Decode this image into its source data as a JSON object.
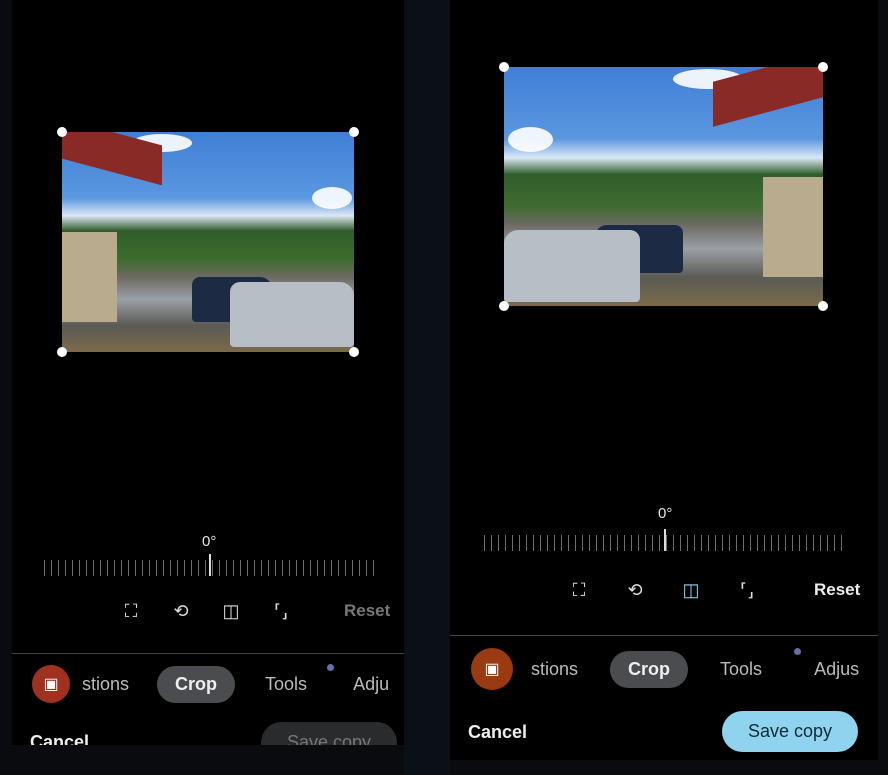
{
  "panels": [
    {
      "state": "original",
      "rotation": "0°",
      "reset_label": "Reset",
      "tabs": {
        "suggestions": "stions",
        "crop": "Crop",
        "tools": "Tools",
        "adjust": "Adju"
      },
      "cancel_label": "Cancel",
      "save_label": "Save copy",
      "save_enabled": false,
      "flip_active": false
    },
    {
      "state": "flipped",
      "rotation": "0°",
      "reset_label": "Reset",
      "tabs": {
        "suggestions": "stions",
        "crop": "Crop",
        "tools": "Tools",
        "adjust": "Adjus"
      },
      "cancel_label": "Cancel",
      "save_label": "Save copy",
      "save_enabled": true,
      "flip_active": true
    }
  ],
  "colors": {
    "save_active": "#8fd3ef",
    "save_disabled": "#2a2b2d",
    "flip_active": "#8fd3ef",
    "magic_button": "#a0301f",
    "tools_dot": "#6a6ea8"
  },
  "icons": [
    "aspect-ratio-icon",
    "rotate-icon",
    "flip-icon",
    "free-crop-icon",
    "magic-editor-icon"
  ]
}
